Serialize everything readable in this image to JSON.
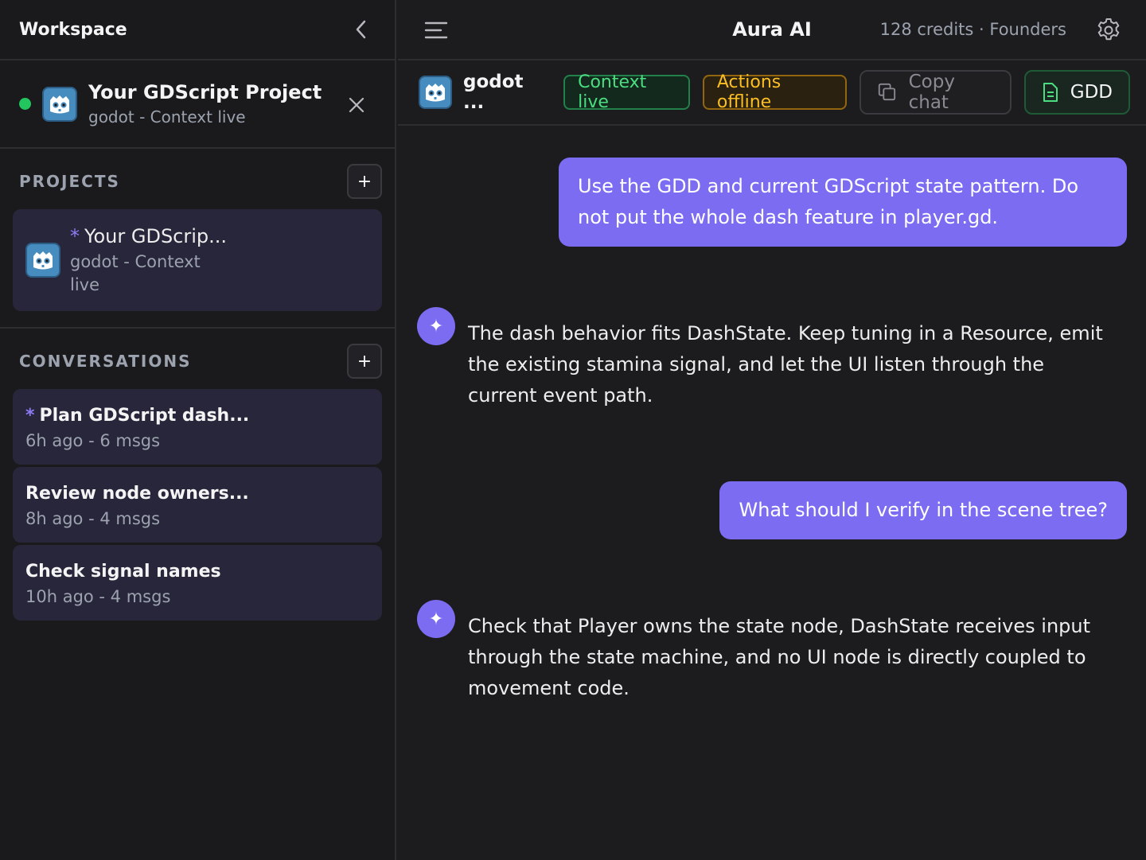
{
  "sidebar": {
    "title": "Workspace",
    "active_project": {
      "title": "Your GDScript Project",
      "subtitle": "godot - Context live",
      "status_color": "#22c55e"
    },
    "projects_heading": "PROJECTS",
    "projects": [
      {
        "star": "*",
        "title": "Your GDScrip...",
        "subtitle": "godot - Context live"
      }
    ],
    "conversations_heading": "CONVERSATIONS",
    "conversations": [
      {
        "star": "*",
        "title": "Plan GDScript dash...",
        "meta": "6h ago - 6 msgs"
      },
      {
        "title": "Review node owners...",
        "meta": "8h ago - 4 msgs"
      },
      {
        "title": "Check signal names",
        "meta": "10h ago - 4 msgs"
      }
    ],
    "plus": "+"
  },
  "topbar": {
    "title": "Aura AI",
    "credits": "128 credits · Founders"
  },
  "toolbar": {
    "project_name": "godot ...",
    "context_badge": "Context live",
    "actions_badge": "Actions offline",
    "copy_label": "Copy chat",
    "gdd_label": "GDD"
  },
  "messages": [
    {
      "role": "user",
      "text": "Use the GDD and current GDScript state pattern. Do not put the whole dash feature in player.gd."
    },
    {
      "role": "assistant",
      "text": "The dash behavior fits DashState. Keep tuning in a Resource, emit the existing stamina signal, and let the UI listen through the current event path."
    },
    {
      "role": "user",
      "text": "What should I verify in the scene tree?"
    },
    {
      "role": "assistant",
      "text": "Check that Player owns the state node, DashState receives input through the state machine, and no UI node is directly coupled to movement code."
    }
  ],
  "colors": {
    "accent": "#7c6cf2",
    "live": "#4ade80",
    "offline": "#fbbf24"
  },
  "icons": {
    "assistant_avatar": "sparkle-icon"
  }
}
